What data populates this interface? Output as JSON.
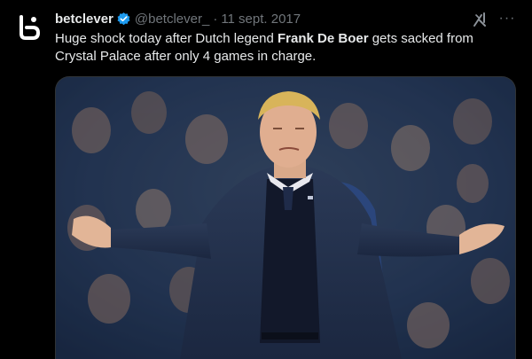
{
  "tweet": {
    "author_name": "betclever",
    "handle": "@betclever_",
    "separator": "·",
    "date": "11 sept. 2017",
    "text_parts": {
      "p1": "Huge shock today after Dutch legend ",
      "bold": "Frank De Boer",
      "p2": " gets sacked from Crystal Palace after only 4 games in charge."
    },
    "more_label": "···"
  },
  "icons": {
    "avatar": "betclever-logo-icon",
    "verified": "verified-badge-icon",
    "grok": "grok-icon",
    "more": "more-icon"
  },
  "colors": {
    "background": "#000000",
    "text": "#e7e9ea",
    "secondary": "#71767b",
    "verified": "#1d9bf0",
    "border": "#2f3336"
  },
  "media": {
    "description_alt": "Photo"
  }
}
